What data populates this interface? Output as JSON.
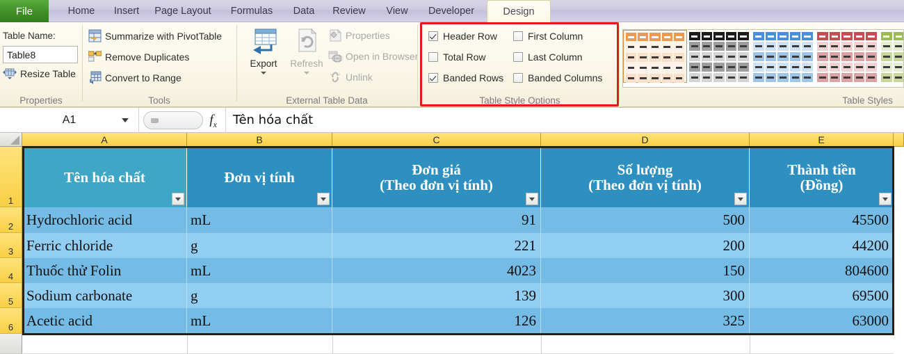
{
  "window": {
    "app": "Microsoft Excel",
    "tabs": [
      {
        "label": "File",
        "state": "file"
      },
      {
        "label": "Home",
        "state": "normal"
      },
      {
        "label": "Insert",
        "state": "normal"
      },
      {
        "label": "Page Layout",
        "state": "normal"
      },
      {
        "label": "Formulas",
        "state": "normal"
      },
      {
        "label": "Data",
        "state": "normal"
      },
      {
        "label": "Review",
        "state": "normal"
      },
      {
        "label": "View",
        "state": "normal"
      },
      {
        "label": "Developer",
        "state": "normal"
      },
      {
        "label": "Design",
        "state": "active"
      }
    ]
  },
  "ribbon": {
    "properties": {
      "group_label": "Properties",
      "table_name_label": "Table Name:",
      "table_name_value": "Table8",
      "resize_table": "Resize Table"
    },
    "tools": {
      "group_label": "Tools",
      "items": [
        {
          "label": "Summarize with PivotTable",
          "icon": "pivottable-icon",
          "disabled": false
        },
        {
          "label": "Remove Duplicates",
          "icon": "remove-duplicates-icon",
          "disabled": false
        },
        {
          "label": "Convert to Range",
          "icon": "convert-to-range-icon",
          "disabled": false
        }
      ]
    },
    "external_table_data": {
      "group_label": "External Table Data",
      "export_label": "Export",
      "refresh_label": "Refresh",
      "items": [
        {
          "label": "Properties",
          "icon": "properties-icon",
          "disabled": true
        },
        {
          "label": "Open in Browser",
          "icon": "open-in-browser-icon",
          "disabled": true
        },
        {
          "label": "Unlink",
          "icon": "unlink-icon",
          "disabled": true
        }
      ]
    },
    "table_style_options": {
      "group_label": "Table Style Options",
      "highlight_color": "#e01b1b",
      "options": [
        {
          "label": "Header Row",
          "checked": true
        },
        {
          "label": "First Column",
          "checked": false
        },
        {
          "label": "Total Row",
          "checked": false
        },
        {
          "label": "Last Column",
          "checked": false
        },
        {
          "label": "Banded Rows",
          "checked": true
        },
        {
          "label": "Banded Columns",
          "checked": false
        }
      ]
    },
    "table_styles": {
      "group_label": "Table Styles",
      "swatches": [
        {
          "name": "orange",
          "header": "#ed9a4e",
          "band_a": "#fbe0c9",
          "band_b": "#fdf2e7",
          "border": "#e08a38",
          "selected": true
        },
        {
          "name": "black",
          "header": "#1c1c1c",
          "band_a": "#9e9e9e",
          "band_b": "#d4d4d4",
          "border": "#ffffff",
          "selected": false
        },
        {
          "name": "blue",
          "header": "#4a90d9",
          "band_a": "#9fc6e8",
          "band_b": "#cfe2f4",
          "border": "#ffffff",
          "selected": false
        },
        {
          "name": "red",
          "header": "#c34f50",
          "band_a": "#dba3a4",
          "band_b": "#efd3d3",
          "border": "#ffffff",
          "selected": false
        },
        {
          "name": "green",
          "header": "#9bbb59",
          "band_a": "#c6d89b",
          "band_b": "#e4ecd2",
          "border": "#ffffff",
          "selected": false
        }
      ]
    }
  },
  "formula_bar": {
    "name_box_value": "A1",
    "fx_label": "fx",
    "formula_value": "Tên hóa chất"
  },
  "sheet": {
    "column_headers": [
      "A",
      "B",
      "C",
      "D",
      "E"
    ],
    "row_headers": [
      "1",
      "2",
      "3",
      "4",
      "5",
      "6"
    ],
    "header_colors": [
      "#3fa7c6",
      "#2e90c0",
      "#2e90c0",
      "#2e90c0",
      "#2e90c0"
    ],
    "band_colors": [
      "#74bbe6",
      "#92cdf2"
    ],
    "table": {
      "headers": [
        {
          "line1": "Tên hóa chất",
          "line2": ""
        },
        {
          "line1": "Đơn vị tính",
          "line2": ""
        },
        {
          "line1": "Đơn giá",
          "line2": "(Theo đơn vị tính)"
        },
        {
          "line1": "Số lượng",
          "line2": "(Theo đơn vị tính)"
        },
        {
          "line1": "Thành tiền",
          "line2": "(Đồng)"
        }
      ],
      "rows": [
        [
          "Hydrochloric acid",
          "mL",
          "91",
          "500",
          "45500"
        ],
        [
          "Ferric chloride",
          "g",
          "221",
          "200",
          "44200"
        ],
        [
          "Thuốc thử Folin",
          "mL",
          "4023",
          "150",
          "804600"
        ],
        [
          "Sodium carbonate",
          "g",
          "139",
          "300",
          "69500"
        ],
        [
          "Acetic acid",
          "mL",
          "126",
          "325",
          "63000"
        ]
      ]
    }
  }
}
